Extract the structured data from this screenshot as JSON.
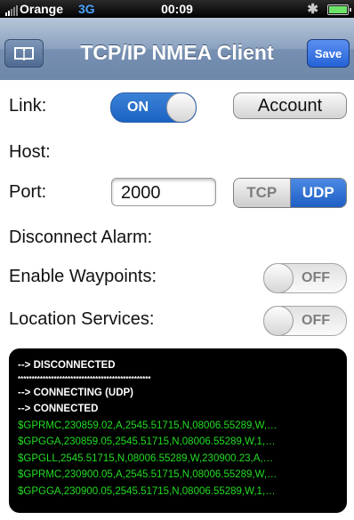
{
  "status_bar": {
    "carrier": "Orange",
    "network": "3G",
    "time": "00:09",
    "bluetooth_icon": "bluetooth-icon",
    "battery_icon": "battery-icon"
  },
  "navbar": {
    "title": "TCP/IP NMEA Client",
    "left_icon": "book-icon",
    "save_label": "Save"
  },
  "form": {
    "link_label": "Link:",
    "link_toggle": "ON",
    "account_label": "Account",
    "host_label": "Host:",
    "port_label": "Port:",
    "port_value": "2000",
    "protocol_options": [
      "TCP",
      "UDP"
    ],
    "protocol_selected": "UDP",
    "disconnect_alarm_label": "Disconnect Alarm:",
    "waypoints_label": "Enable Waypoints:",
    "waypoints_toggle": "OFF",
    "location_label": "Location Services:",
    "location_toggle": "OFF"
  },
  "console": {
    "lines": [
      "--> DISCONNECTED",
      "************************************************",
      "--> CONNECTING (UDP)",
      "--> CONNECTED",
      "$GPRMC,230859.02,A,2545.51715,N,08006.55289,W,…",
      "$GPGGA,230859.05,2545.51715,N,08006.55289,W,1,…",
      "$GPGLL,2545.51715,N,08006.55289,W,230900.23,A,…",
      "$GPRMC,230900.05,A,2545.51715,N,08006.55289,W,…",
      "$GPGGA,230900.05,2545.51715,N,08006.55289,W,1,…"
    ]
  }
}
